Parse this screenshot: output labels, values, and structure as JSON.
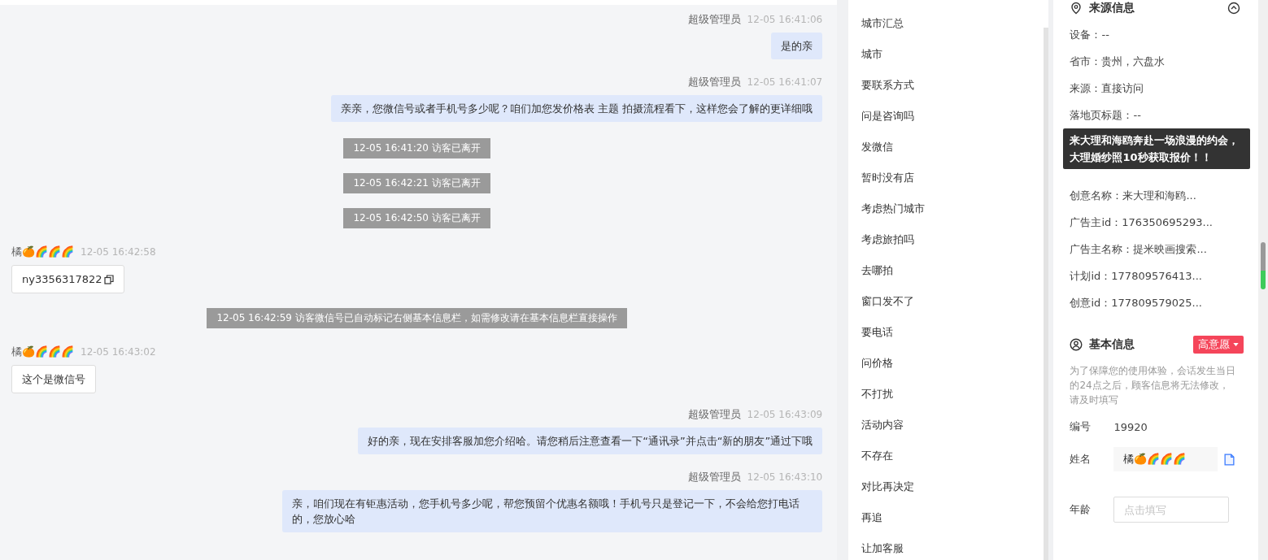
{
  "chat": {
    "messages": [
      {
        "kind": "agent",
        "sender": "超级管理员",
        "time": "12-05 16:41:06",
        "text": "是的亲"
      },
      {
        "kind": "agent",
        "sender": "超级管理员",
        "time": "12-05 16:41:07",
        "text": "亲亲，您微信号或者手机号多少呢？咱们加您发价格表 主题 拍摄流程看下，这样您会了解的更详细哦"
      },
      {
        "kind": "system",
        "text": "12-05 16:41:20 访客已离开"
      },
      {
        "kind": "system",
        "text": "12-05 16:42:21 访客已离开"
      },
      {
        "kind": "system",
        "text": "12-05 16:42:50 访客已离开"
      },
      {
        "kind": "visitor",
        "sender": "橘🍊🌈🌈🌈",
        "time": "12-05 16:42:58",
        "text": "ny3356317822",
        "copyable": true
      },
      {
        "kind": "system",
        "text": "12-05 16:42:59 访客微信号已自动标记右侧基本信息栏，如需修改请在基本信息栏直接操作"
      },
      {
        "kind": "visitor",
        "sender": "橘🍊🌈🌈🌈",
        "time": "12-05 16:43:02",
        "text": "这个是微信号",
        "copyable": false
      },
      {
        "kind": "agent",
        "sender": "超级管理员",
        "time": "12-05 16:43:09",
        "text": "好的亲，现在安排客服加您介绍哈。请您稍后注意查看一下“通讯录”并点击“新的朋友”通过下哦"
      },
      {
        "kind": "agent",
        "sender": "超级管理员",
        "time": "12-05 16:43:10",
        "text": "亲，咱们现在有钜惠活动，您手机号多少呢，帮您预留个优惠名额哦！手机号只是登记一下，不会给您打电话的，您放心哈"
      }
    ]
  },
  "quick_replies": [
    "城市汇总",
    "城市",
    "要联系方式",
    "问是咨询吗",
    "发微信",
    "暂时没有店",
    "考虑热门城市",
    "考虑旅拍吗",
    "去哪拍",
    "窗口发不了",
    "要电话",
    "问价格",
    "不打扰",
    "活动内容",
    "不存在",
    "对比再决定",
    "再追",
    "让加客服"
  ],
  "source_info": {
    "title": "来源信息",
    "rows_before": [
      "设备：--",
      "省市：贵州，六盘水",
      "来源：直接访问",
      "落地页标题：--"
    ],
    "tooltip": "来大理和海鸥奔赴一场浪漫的约会，大理婚纱照10秒获取报价！！",
    "rows_after": [
      "创意名称：来大理和海鸥...",
      "广告主id：176350695293...",
      "广告主名称：提米映画搜索...",
      "计划id：177809576413...",
      "创意id：177809579025..."
    ]
  },
  "basic_info": {
    "title": "基本信息",
    "intent": "高意愿",
    "note": "为了保障您的使用体验，会话发生当日的24点之后，顾客信息将无法修改，请及时填写",
    "fields": [
      {
        "kind": "text",
        "label": "编号",
        "value": "19920"
      },
      {
        "kind": "readonly",
        "label": "姓名",
        "value": "橘🍊🌈🌈🌈"
      },
      {
        "kind": "input",
        "label": "年龄",
        "placeholder": "点击填写"
      }
    ]
  }
}
